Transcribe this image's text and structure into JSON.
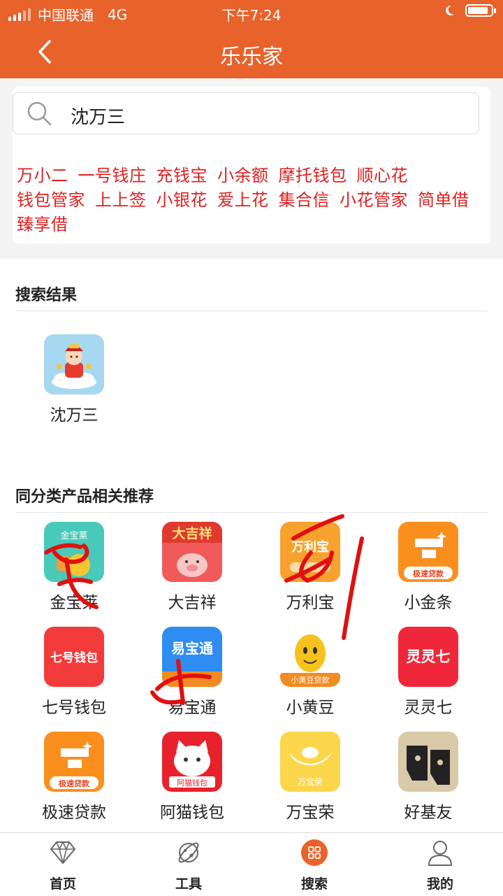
{
  "status_bar": {
    "carrier": "中国联通",
    "network": "4G",
    "time": "下午7:24"
  },
  "header": {
    "title": "乐乐家"
  },
  "search": {
    "value": "沈万三"
  },
  "hot_words": [
    "万小二",
    "一号钱庄",
    "充钱宝",
    "小余额",
    "摩托钱包",
    "顺心花",
    "钱包管家",
    "上上签",
    "小银花",
    "爱上花",
    "集合信",
    "小花管家",
    "简单借",
    "臻享借"
  ],
  "results": {
    "title": "搜索结果",
    "items": [
      {
        "name": "沈万三",
        "icon": "caishen-icon"
      }
    ]
  },
  "recommend": {
    "title": "同分类产品相关推荐",
    "items": [
      {
        "name": "金宝莱",
        "icon": "jinbaolai-icon",
        "icon_text": "金宝莱"
      },
      {
        "name": "大吉祥",
        "icon": "dajixiang-icon",
        "icon_text": "大吉祥"
      },
      {
        "name": "万利宝",
        "icon": "wanlibao-icon",
        "icon_text": "万利宝"
      },
      {
        "name": "小金条",
        "icon": "gold-bars-icon",
        "icon_text": "极速贷款"
      },
      {
        "name": "七号钱包",
        "icon": "qihao-icon",
        "icon_text": "七号钱包"
      },
      {
        "name": "易宝通",
        "icon": "yibaotong-icon",
        "icon_text": "易宝通"
      },
      {
        "name": "小黄豆",
        "icon": "bean-icon",
        "icon_text": "小黄豆贷款"
      },
      {
        "name": "灵灵七",
        "icon": "linglingqi-icon",
        "icon_text": "灵灵七"
      },
      {
        "name": "极速贷款",
        "icon": "gold-bars-icon",
        "icon_text": "极速贷款"
      },
      {
        "name": "阿猫钱包",
        "icon": "lucky-cat-icon",
        "icon_text": "阿猫钱包"
      },
      {
        "name": "万宝荣",
        "icon": "ingot-icon",
        "icon_text": "万宝荣"
      },
      {
        "name": "好基友",
        "icon": "faces-icon",
        "icon_text": ""
      }
    ]
  },
  "tabs": [
    {
      "label": "首页",
      "icon": "diamond-icon"
    },
    {
      "label": "工具",
      "icon": "planet-icon"
    },
    {
      "label": "搜索",
      "icon": "grid-icon",
      "active": true
    },
    {
      "label": "我的",
      "icon": "user-icon"
    }
  ],
  "colors": {
    "brand": "#e8622c",
    "hot_word": "#e02020",
    "annotation": "#e01010"
  }
}
